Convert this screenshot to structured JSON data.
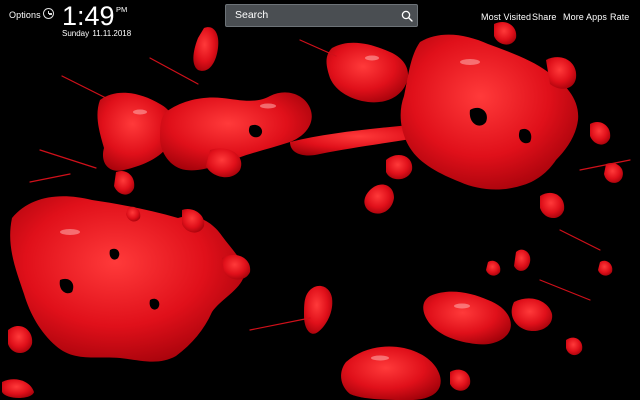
{
  "topbar": {
    "options_label": "Options"
  },
  "clock": {
    "time": "1:49",
    "ampm": "PM",
    "date": "Sunday  11.11.2018"
  },
  "search": {
    "placeholder": "Search"
  },
  "nav": {
    "most_visited": "Most Visited",
    "share": "Share",
    "more_apps": "More Apps",
    "rate": "Rate"
  },
  "colors": {
    "background": "#000000",
    "paint": "#e0101a",
    "search_bg": "#5a5f64"
  }
}
